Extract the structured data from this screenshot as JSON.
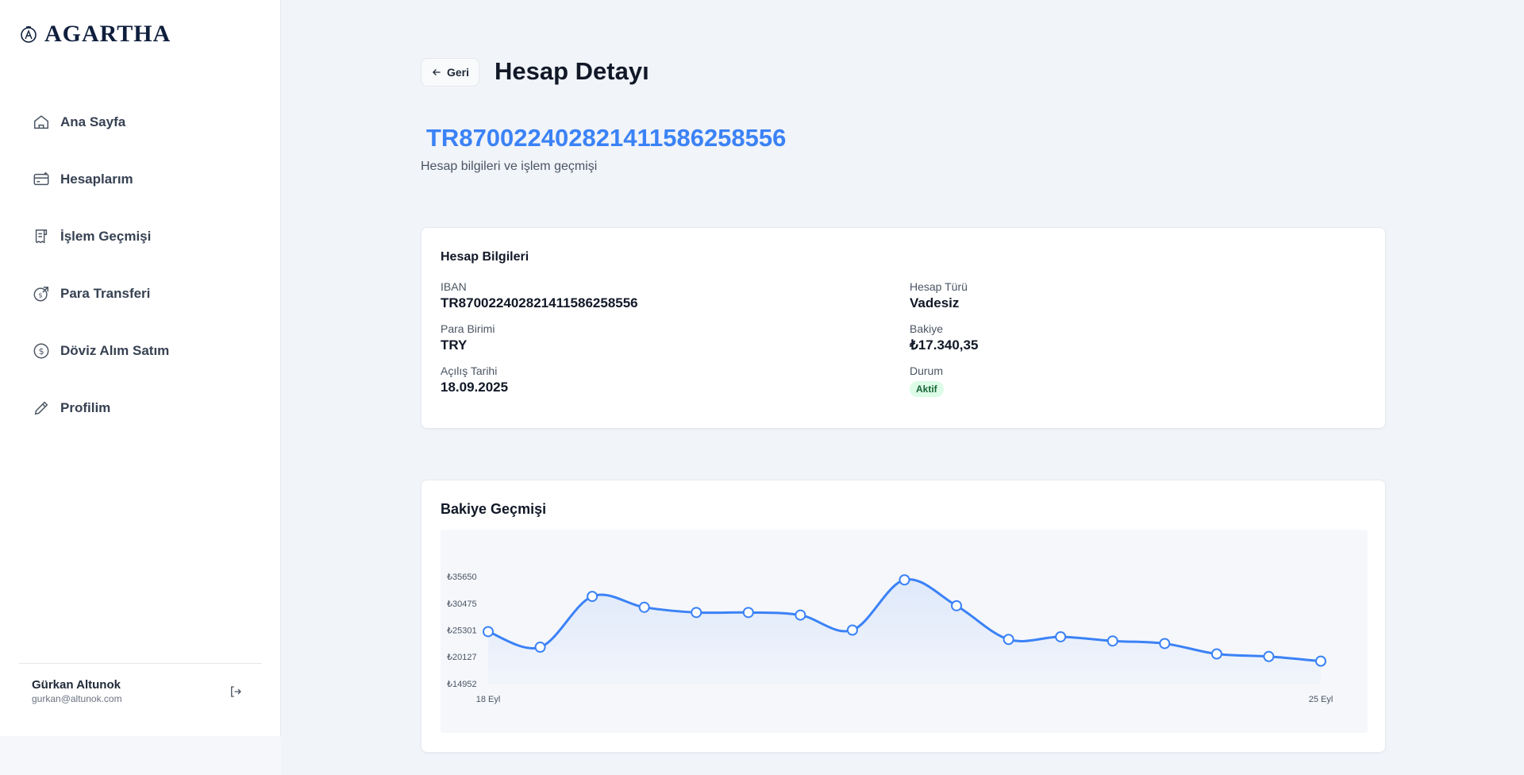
{
  "brand": {
    "name": "AGARTHA"
  },
  "sidebar": {
    "items": [
      {
        "label": "Ana Sayfa",
        "icon": "home-icon"
      },
      {
        "label": "Hesaplarım",
        "icon": "credit-card-icon"
      },
      {
        "label": "İşlem Geçmişi",
        "icon": "receipt-icon"
      },
      {
        "label": "Para Transferi",
        "icon": "money-transfer-icon"
      },
      {
        "label": "Döviz Alım Satım",
        "icon": "dollar-circle-icon"
      },
      {
        "label": "Profilim",
        "icon": "pencil-icon"
      }
    ]
  },
  "user": {
    "name": "Gürkan Altunok",
    "email": "gurkan@altunok.com"
  },
  "header": {
    "back_label": "Geri",
    "title": "Hesap Detayı",
    "iban": "TR870022402821411586258556",
    "subtitle": "Hesap bilgileri ve işlem geçmişi"
  },
  "account_info": {
    "title": "Hesap Bilgileri",
    "iban_label": "IBAN",
    "iban_value": "TR870022402821411586258556",
    "type_label": "Hesap Türü",
    "type_value": "Vadesiz",
    "currency_label": "Para Birimi",
    "currency_value": "TRY",
    "balance_label": "Bakiye",
    "balance_value": "₺17.340,35",
    "opened_label": "Açılış Tarihi",
    "opened_value": "18.09.2025",
    "status_label": "Durum",
    "status_value": "Aktif"
  },
  "colors": {
    "accent": "#3b82f6",
    "status_bg": "#dcfce7",
    "status_text": "#166534"
  },
  "chart_data": {
    "type": "line",
    "title": "Bakiye Geçmişi",
    "ylim": [
      14952,
      35650
    ],
    "y_ticks": [
      "₺35650",
      "₺30475",
      "₺25301",
      "₺20127",
      "₺14952"
    ],
    "y_tick_values": [
      35650,
      30475,
      25301,
      20127,
      14952
    ],
    "x_tick_labels": [
      "18 Eyl",
      "25 Eyl"
    ],
    "values": [
      25000,
      22000,
      31800,
      29700,
      28700,
      28700,
      28200,
      25300,
      35000,
      30000,
      23500,
      24000,
      23200,
      22700,
      20700,
      20200,
      19300
    ],
    "grid": false,
    "legend": "none",
    "line_color": "#3b82f6"
  }
}
